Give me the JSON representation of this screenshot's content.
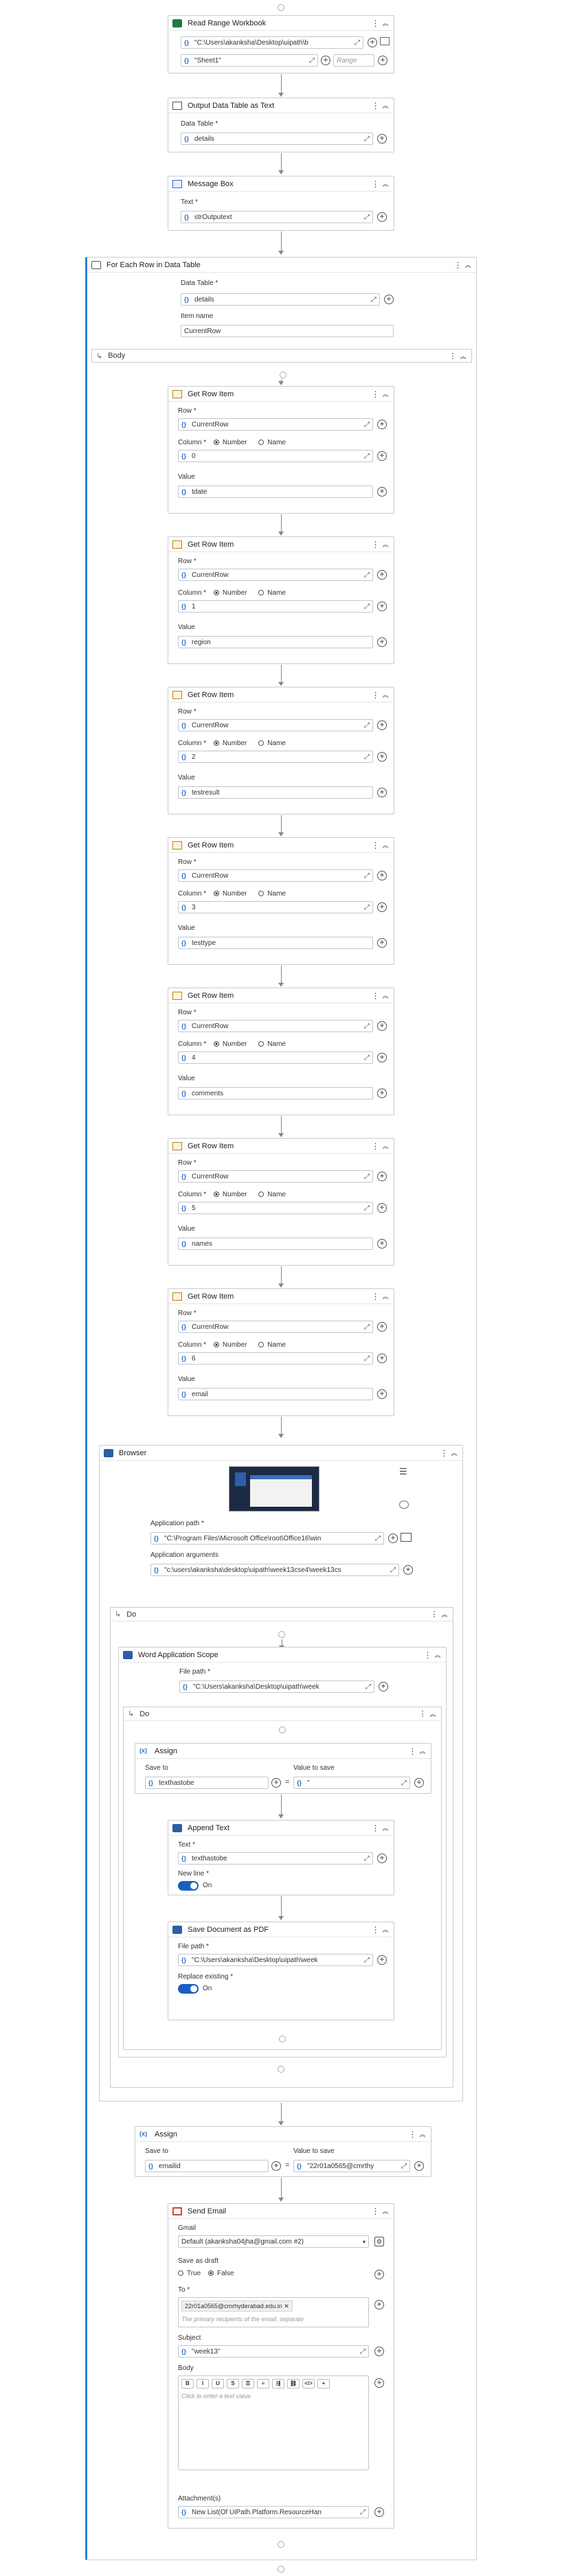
{
  "activities": {
    "read_range": {
      "title": "Read Range Workbook",
      "path": "\"C:\\Users\\akanksha\\Desktop\\uipath\\b",
      "sheet": "\"Sheet1\"",
      "range_ph": "Range"
    },
    "output_dt": {
      "title": "Output Data Table as Text",
      "lbl": "Data Table *",
      "val": "details"
    },
    "msgbox": {
      "title": "Message Box",
      "lbl": "Text *",
      "val": "strOutputext"
    },
    "foreach": {
      "title": "For Each Row in Data Table",
      "dt_lbl": "Data Table *",
      "dt_val": "details",
      "item_lbl": "Item name",
      "item_val": "CurrentRow",
      "body": "Body"
    },
    "getrow_common": {
      "title": "Get Row Item",
      "row_lbl": "Row *",
      "row_val": "CurrentRow",
      "col_lbl": "Column *",
      "opt_number": "Number",
      "opt_name": "Name",
      "value_lbl": "Value"
    },
    "getrows": [
      {
        "col": "0",
        "value": "tdate"
      },
      {
        "col": "1",
        "value": "region"
      },
      {
        "col": "2",
        "value": "testresult"
      },
      {
        "col": "3",
        "value": "testtype"
      },
      {
        "col": "4",
        "value": "comments"
      },
      {
        "col": "5",
        "value": "names"
      },
      {
        "col": "6",
        "value": "email"
      }
    ],
    "browser": {
      "title": "Browser",
      "app_path_lbl": "Application path *",
      "app_path": "\"C:\\Program Files\\Microsoft Office\\root\\Office16\\win",
      "app_args_lbl": "Application arguments",
      "app_args": "\"c:\\users\\akanksha\\desktop\\uipath\\week13cse4\\week13cs"
    },
    "do1": {
      "title": "Do"
    },
    "word_scope": {
      "title": "Word Application Scope",
      "file_lbl": "File path *",
      "file_val": "\"C:\\Users\\akanksha\\Desktop\\uipath\\week"
    },
    "do2": {
      "title": "Do"
    },
    "assign1": {
      "title": "Assign",
      "save_lbl": "Save to",
      "save_val": "texthastobe",
      "value_lbl": "Value to save",
      "value_val": "\""
    },
    "append": {
      "title": "Append Text",
      "text_lbl": "Text *",
      "text_val": "texthastobe",
      "newline_lbl": "New line *",
      "newline_state": "On"
    },
    "savepdf": {
      "title": "Save Document as PDF",
      "file_lbl": "File path *",
      "file_val": "\"C:\\Users\\akanksha\\Desktop\\uipath\\week",
      "replace_lbl": "Replace existing *",
      "replace_state": "On"
    },
    "assign2": {
      "title": "Assign",
      "save_lbl": "Save to",
      "save_val": "emailid",
      "value_lbl": "Value to save",
      "value_val": "\"22r01a0565@cmrthy"
    },
    "email": {
      "title": "Send Email",
      "gmail_lbl": "Gmail",
      "gmail_val": "Default (akanksha04jha@gmail.com #2)",
      "draft_lbl": "Save as draft",
      "draft_true": "True",
      "draft_false": "False",
      "to_lbl": "To *",
      "to_chip": "22r01a0565@cmrhyderabad.edu.in",
      "to_ph": "The primary recipients of the email, separate",
      "subject_lbl": "Subject",
      "subject_val": "\"week13\"",
      "body_lbl": "Body",
      "body_ph": "Click to enter a text value",
      "attach_lbl": "Attachment(s)",
      "attach_val": "New List(Of UiPath.Platform.ResourceHan"
    }
  },
  "toolbar_icons": [
    "bold-icon",
    "italic-icon",
    "underline-icon",
    "strikethrough-icon",
    "bullet-list-icon",
    "numbered-list-icon",
    "align-icon",
    "link-icon",
    "code-icon",
    "plus-icon"
  ],
  "toolbar_glyphs": [
    "B",
    "I",
    "U",
    "S",
    "☰",
    "≡",
    "⇶",
    "⛓",
    "</>",
    "+"
  ],
  "accent_color": "#2e7fd7",
  "toggle_color": "#1a5fc0"
}
